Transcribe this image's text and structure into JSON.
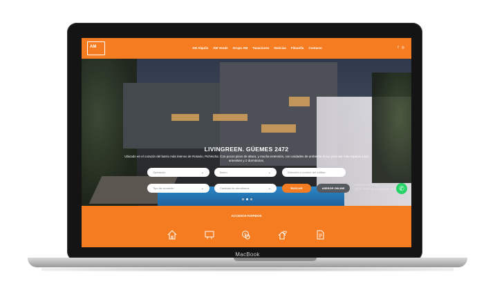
{
  "device": {
    "brand": "MacBook"
  },
  "site": {
    "logo_text": "AM",
    "nav": [
      "AM Alquila",
      "AM Vende",
      "Grupo AM",
      "Tasaciones",
      "Noticias",
      "Filosofía",
      "Contacto"
    ],
    "social": [
      "f",
      "◎"
    ]
  },
  "hero": {
    "title": "LIVINGREEN. GÜEMES 2472",
    "description": "Ubicado en el corazón del barrio más intenso de Rosario, Pichincha. Con pocos pisos de altura, y mucha extensión, con unidades de ambiente único para dar más espacio a los amenities y 2 dormitorios.",
    "fields": {
      "operacion": "Operación",
      "barrio": "Barrio",
      "direccion": "Dirección o nombre del edificio",
      "tipo": "Tipo de inmueble",
      "dormitorios": "Cantidad de dormitorios"
    },
    "search_label": "BUSCAR",
    "online_label": "ASESOR ONLINE",
    "windows_notice": "Activate Windows\nGo to Settings to activate Windows."
  },
  "quick_access": {
    "title": "ACCESOS RÁPIDOS",
    "icons": [
      "house-icon",
      "sale-sign-icon",
      "money-icon",
      "house-heart-icon",
      "document-icon"
    ]
  }
}
